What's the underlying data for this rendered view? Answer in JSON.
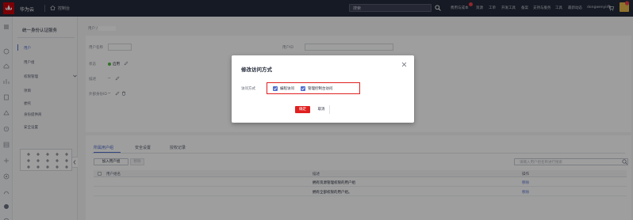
{
  "topbar": {
    "brand": "华为云",
    "console": "控制台",
    "search_placeholder": "搜索",
    "nav": [
      "费用与成本",
      "资源",
      "工单",
      "开发工具",
      "备案",
      "支持与服务",
      "工具",
      "最新动态"
    ],
    "username": "dongwenying"
  },
  "sidebar": {
    "title": "统一身份认证服务",
    "items": [
      {
        "label": "用户",
        "active": true
      },
      {
        "label": "用户组",
        "active": false
      },
      {
        "label": "权限管理",
        "active": false
      },
      {
        "label": "项目",
        "active": false
      },
      {
        "label": "委托",
        "active": false
      },
      {
        "label": "身份提供商",
        "active": false
      },
      {
        "label": "安全设置",
        "active": false
      }
    ]
  },
  "breadcrumb": "用户 /",
  "user_info": {
    "name_label": "用户名称",
    "id_label": "用户ID",
    "status_label": "状态",
    "status_value": "启用",
    "desc_label": "描述",
    "desc_value": "--",
    "ext_label": "外部身份ID",
    "ext_value": "--"
  },
  "tabs": [
    "所属用户组",
    "安全设置",
    "授权记录"
  ],
  "table": {
    "add_button": "加入用户组",
    "remove_button": "移除",
    "search_placeholder": "请输入用户组名称进行搜索",
    "headers": {
      "name": "用户组名",
      "desc": "描述",
      "ops": "操作"
    },
    "rows": [
      {
        "desc": "拥有资源管理权限的用户组",
        "op": "移除"
      },
      {
        "desc": "拥有全部权限的用户组。",
        "op": "移除"
      }
    ]
  },
  "dialog": {
    "title": "修改访问方式",
    "access_label": "访问方式",
    "options": [
      {
        "label": "编程访问",
        "checked": true
      },
      {
        "label": "管理控制台访问",
        "checked": true
      }
    ],
    "ok": "确定",
    "cancel": "取消"
  },
  "colors": {
    "accent": "#526ecc",
    "danger": "#e02020",
    "topbar": "#252b3a",
    "success": "#50b83c"
  }
}
